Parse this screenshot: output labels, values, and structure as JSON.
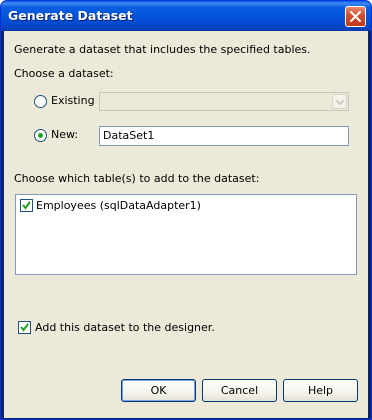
{
  "window": {
    "title": "Generate Dataset"
  },
  "intro": "Generate a dataset that includes the specified tables.",
  "choose_dataset": {
    "label": "Choose a dataset:",
    "existing": {
      "label": "Existing",
      "selected": false,
      "value": ""
    },
    "new": {
      "label": "New:",
      "selected": true,
      "value": "DataSet1"
    }
  },
  "tables": {
    "label": "Choose which table(s) to add to the dataset:",
    "items": [
      {
        "label": "Employees (sqlDataAdapter1)",
        "checked": true
      }
    ]
  },
  "add_to_designer": {
    "label": "Add this dataset to the designer.",
    "checked": true
  },
  "buttons": {
    "ok": "OK",
    "cancel": "Cancel",
    "help": "Help"
  },
  "colors": {
    "title_bar": "#0450d8",
    "dialog_face": "#ece9d8",
    "radio_dot": "#21a121",
    "close_button": "#d0502f"
  },
  "icons": [
    "close-icon",
    "chevron-down-icon",
    "checkmark-icon"
  ]
}
